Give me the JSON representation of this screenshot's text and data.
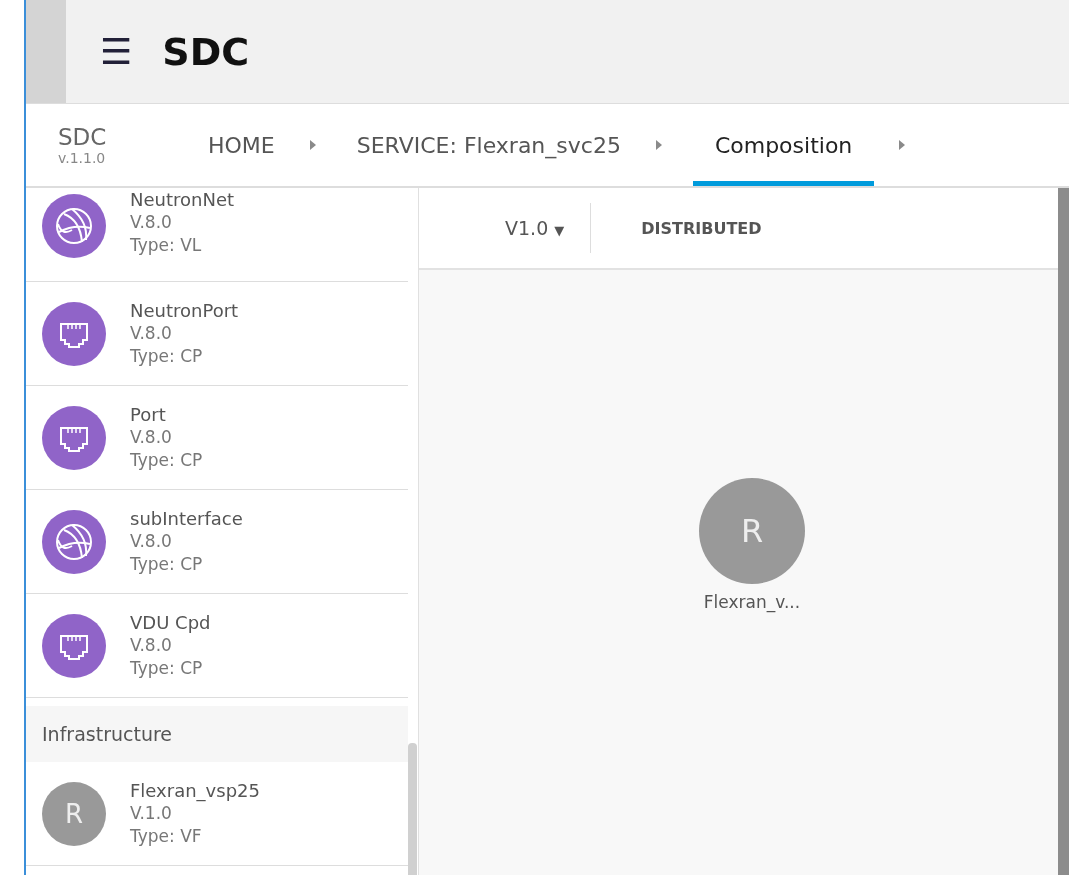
{
  "app_bar": {
    "menu_icon": "☰",
    "title": "SDC"
  },
  "nav": {
    "product": "SDC",
    "version": "v.1.1.0",
    "breadcrumbs": [
      {
        "label": "HOME",
        "selected": false
      },
      {
        "label": "SERVICE: Flexran_svc25",
        "selected": false
      },
      {
        "label": "Composition",
        "selected": true
      }
    ]
  },
  "palette": {
    "items": [
      {
        "kind": "network",
        "name": "NeutronNet",
        "version": "V.8.0",
        "type": "Type: VL"
      },
      {
        "kind": "port",
        "name": "NeutronPort",
        "version": "V.8.0",
        "type": "Type: CP"
      },
      {
        "kind": "port",
        "name": "Port",
        "version": "V.8.0",
        "type": "Type: CP"
      },
      {
        "kind": "network",
        "name": "subInterface",
        "version": "V.8.0",
        "type": "Type: CP"
      },
      {
        "kind": "port",
        "name": "VDU Cpd",
        "version": "V.8.0",
        "type": "Type: CP"
      },
      {
        "kind": "section",
        "name": "Infrastructure"
      },
      {
        "kind": "letter",
        "letter": "R",
        "name": "Flexran_vsp25",
        "version": "V.1.0",
        "type": "Type: VF"
      }
    ]
  },
  "toolbar": {
    "version": "V1.0",
    "dropdown_icon": "▼",
    "status": "DISTRIBUTED"
  },
  "canvas": {
    "nodes": [
      {
        "letter": "R",
        "label": "Flexran_v..."
      }
    ]
  }
}
